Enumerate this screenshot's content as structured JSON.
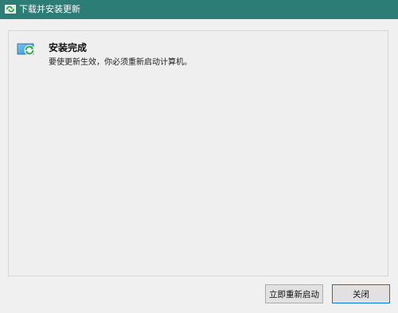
{
  "window": {
    "title": "下载并安装更新",
    "title_icon": "update-app-icon"
  },
  "status": {
    "icon": "update-complete-icon",
    "heading": "安装完成",
    "message": "要使更新生效，你必须重新启动计算机。"
  },
  "buttons": {
    "restart_now": "立即重新启动",
    "close": "关闭"
  },
  "colors": {
    "titlebar": "#2b7d75",
    "accent": "#0078d7"
  }
}
